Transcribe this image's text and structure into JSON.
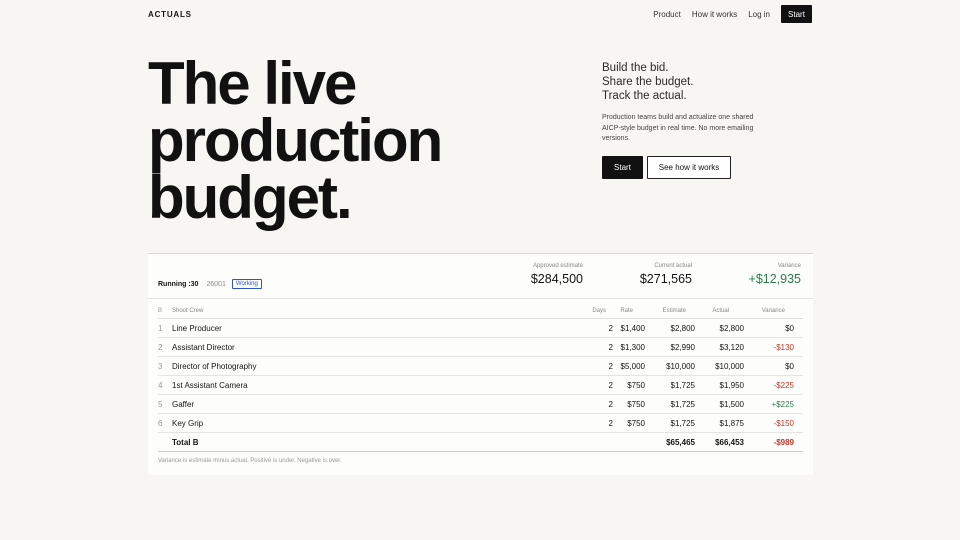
{
  "nav": {
    "brand": "ACTUALS",
    "links": [
      "Product",
      "How it works",
      "Log in"
    ],
    "start": "Start"
  },
  "hero": {
    "title": "The live\nproduction\nbudget.",
    "tagline": "Build the bid.\nShare the budget.\nTrack the actual.",
    "description": "Production teams build and actualize one shared AICP-style budget in real time. No more emailing versions.",
    "primary_cta": "Start",
    "secondary_cta": "See how it works"
  },
  "budget": {
    "running_label": "Running :30",
    "job_id": "26001",
    "status_badge": "Working",
    "metrics": {
      "approved_label": "Approved estimate",
      "approved_value": "$284,500",
      "actual_label": "Current actual",
      "actual_value": "$271,565",
      "variance_label": "Variance",
      "variance_value": "+$12,935"
    },
    "headers": {
      "section": "B",
      "name": "Shoot Crew",
      "days": "Days",
      "rate": "Rate",
      "estimate": "Estimate",
      "actual": "Actual",
      "variance": "Variance"
    },
    "rows": [
      {
        "num": "1",
        "name": "Line Producer",
        "days": "2",
        "rate": "$1,400",
        "estimate": "$2,800",
        "actual": "$2,800",
        "variance": "$0",
        "tone": ""
      },
      {
        "num": "2",
        "name": "Assistant Director",
        "days": "2",
        "rate": "$1,300",
        "estimate": "$2,990",
        "actual": "$3,120",
        "variance": "-$130",
        "tone": "neg"
      },
      {
        "num": "3",
        "name": "Director of Photography",
        "days": "2",
        "rate": "$5,000",
        "estimate": "$10,000",
        "actual": "$10,000",
        "variance": "$0",
        "tone": ""
      },
      {
        "num": "4",
        "name": "1st Assistant Camera",
        "days": "2",
        "rate": "$750",
        "estimate": "$1,725",
        "actual": "$1,950",
        "variance": "-$225",
        "tone": "neg"
      },
      {
        "num": "5",
        "name": "Gaffer",
        "days": "2",
        "rate": "$750",
        "estimate": "$1,725",
        "actual": "$1,500",
        "variance": "+$225",
        "tone": "pos"
      },
      {
        "num": "6",
        "name": "Key Grip",
        "days": "2",
        "rate": "$750",
        "estimate": "$1,725",
        "actual": "$1,875",
        "variance": "-$150",
        "tone": "neg"
      }
    ],
    "total": {
      "name": "Total B",
      "estimate": "$65,465",
      "actual": "$66,453",
      "variance": "-$989"
    },
    "footnote": "Variance is estimate minus actual. Positive is under. Negative is over."
  },
  "colors": {
    "background": "#f7f6f3",
    "positive": "#2e7d4a",
    "negative": "#c0392b",
    "badge": "#2f55c4"
  }
}
